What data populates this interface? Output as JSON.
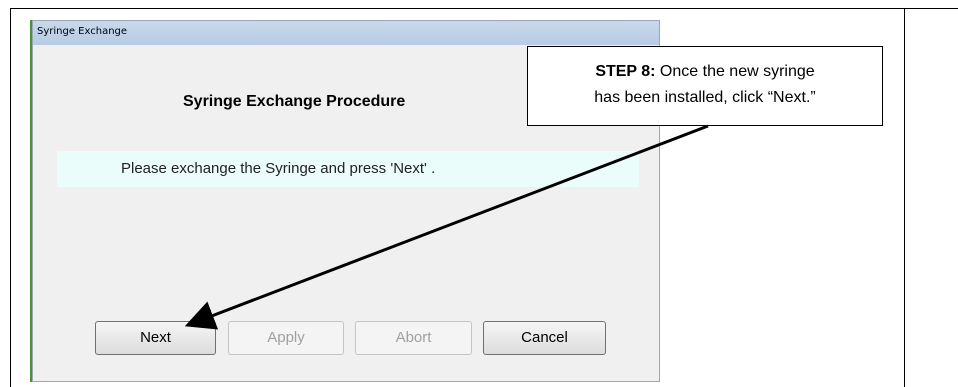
{
  "window": {
    "title": "Syringe Exchange",
    "heading": "Syringe Exchange Procedure",
    "message": "Please exchange the Syringe and press 'Next' ."
  },
  "buttons": {
    "next": "Next",
    "apply": "Apply",
    "abort": "Abort",
    "cancel": "Cancel"
  },
  "callout": {
    "step_label": "STEP 8:",
    "line1_rest": " Once the new syringe",
    "line2": "has been installed, click “Next.”"
  },
  "colors": {
    "message_panel_bg": "#eafdfb",
    "titlebar": "#c9d9ec",
    "accent_left": "#4e8f3a"
  },
  "icons": {
    "annotation_arrow": "arrow-icon"
  }
}
